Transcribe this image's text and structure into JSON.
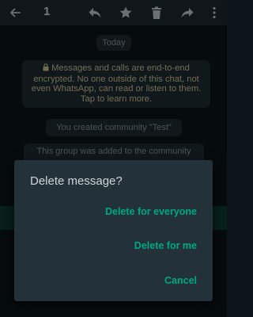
{
  "topbar": {
    "selected_count": "1",
    "back_icon": "arrow-left-icon",
    "reply_icon": "reply-icon",
    "star_icon": "star-icon",
    "delete_icon": "trash-icon",
    "forward_icon": "forward-icon",
    "more_icon": "more-vertical-icon"
  },
  "chat": {
    "date_label": "Today",
    "e2e_notice": "Messages and calls are end-to-end encrypted. No one outside of this chat, not even WhatsApp, can read or listen to them. Tap to learn more.",
    "system_created": "You created community \"Test\"",
    "system_added": "This group was added to the community"
  },
  "dialog": {
    "title": "Delete message?",
    "delete_everyone": "Delete for everyone",
    "delete_me": "Delete for me",
    "cancel": "Cancel"
  },
  "colors": {
    "accent": "#00a884",
    "background": "#0b141a",
    "dialog_bg": "#233138",
    "e2e_text": "#d2c49c"
  }
}
